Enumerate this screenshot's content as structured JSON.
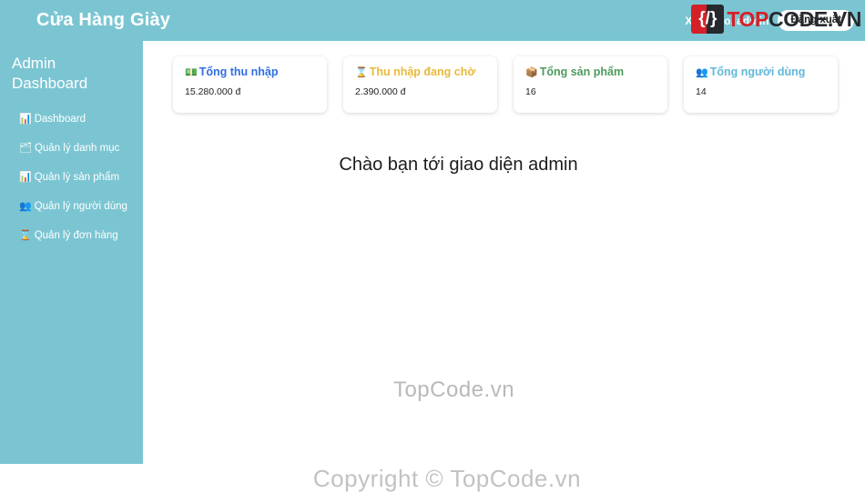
{
  "header": {
    "brand": "Cửa Hàng Giày",
    "greeting": "Xin chào, admin",
    "logout_label": "Đăng xuất",
    "bg_color": "#7bc5d2"
  },
  "sidebar": {
    "title": "Admin Dashboard",
    "bg_color": "#7bc5d2",
    "items": [
      {
        "icon": "bar-chart-icon",
        "glyph": "📊",
        "label": "Dashboard"
      },
      {
        "icon": "folder-icon",
        "glyph": "🗂",
        "label": "Quản lý danh mục"
      },
      {
        "icon": "chart-increasing-icon",
        "glyph": "📊",
        "label": "Quản lý sản phẩm"
      },
      {
        "icon": "users-icon",
        "glyph": "👥",
        "label": "Quản lý người dùng"
      },
      {
        "icon": "hourglass-icon",
        "glyph": "⌛",
        "label": "Quản lý đơn hàng"
      }
    ]
  },
  "main": {
    "cards": [
      {
        "icon": "money-banknote-icon",
        "glyph": "💵",
        "title": "Tổng thu nhập",
        "value": "15.280.000 đ",
        "title_color": "#2f6fe0"
      },
      {
        "icon": "hourglass-icon",
        "glyph": "⌛",
        "title": "Thu nhập đang chờ",
        "value": "2.390.000 đ",
        "title_color": "#e8b93b"
      },
      {
        "icon": "package-box-icon",
        "glyph": "📦",
        "title": "Tổng sản phẩm",
        "value": "16",
        "title_color": "#4e9a5e"
      },
      {
        "icon": "users-icon",
        "glyph": "👥",
        "title": "Tổng người dùng",
        "value": "14",
        "title_color": "#62b8d9"
      }
    ],
    "welcome_heading": "Chào bạn tới giao diện admin"
  },
  "watermarks": {
    "center": "TopCode.vn",
    "bottom": "Copyright © TopCode.vn",
    "badge_glyph": "{/}",
    "badge_top": "TOP",
    "badge_code": "CODE.VN"
  }
}
